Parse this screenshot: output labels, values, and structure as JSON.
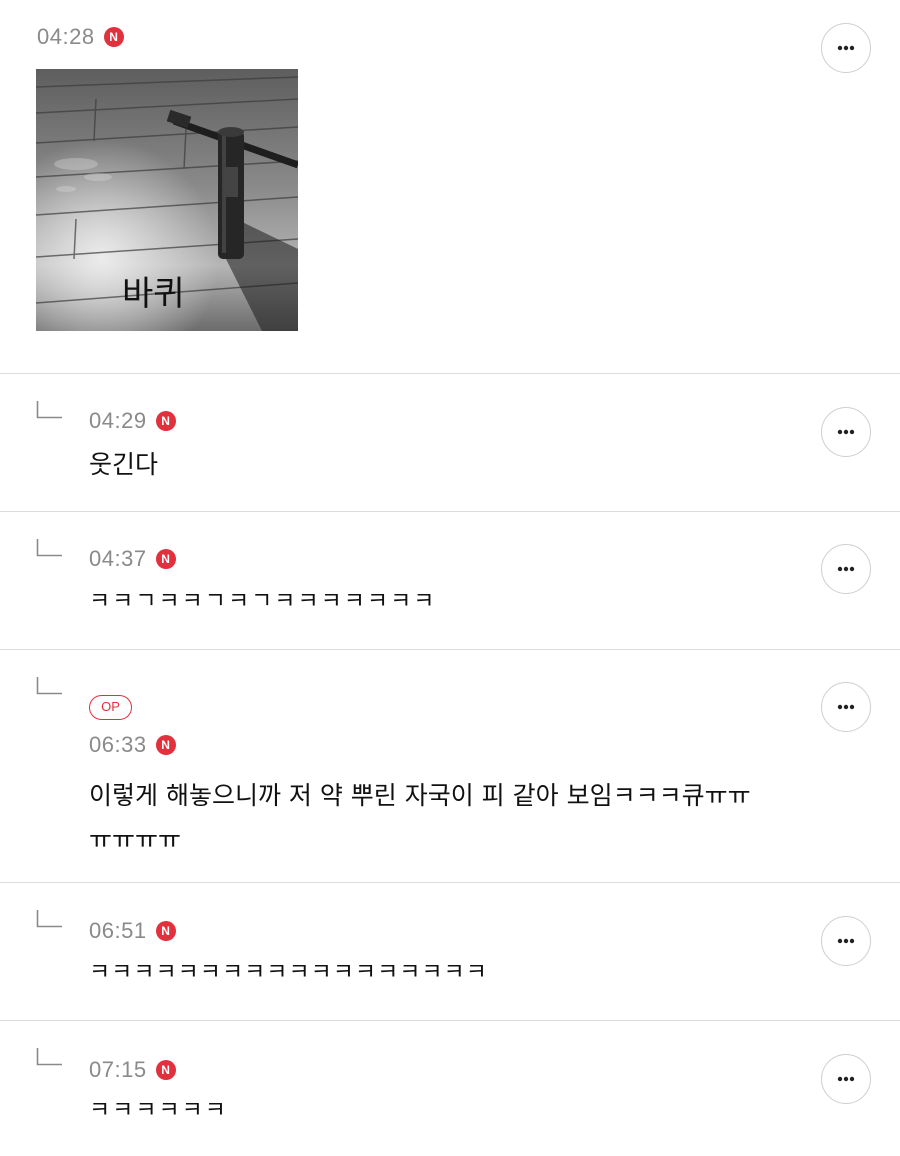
{
  "comments": [
    {
      "time": "04:28",
      "new_badge": "N",
      "is_reply": false,
      "image_caption": "바퀴",
      "more_label": "more options"
    },
    {
      "time": "04:29",
      "new_badge": "N",
      "is_reply": true,
      "text": "웃긴다"
    },
    {
      "time": "04:37",
      "new_badge": "N",
      "is_reply": true,
      "text": "ㅋㅋㄱㅋㅋㄱㅋㄱㅋㅋㅋㅋㅋㅋㅋ"
    },
    {
      "time": "06:33",
      "new_badge": "N",
      "is_reply": true,
      "op_badge": "OP",
      "text": "이렇게 해놓으니까 저 약 뿌린 자국이 피 같아 보임ㅋㅋㅋ큐ㅠㅠ\nㅠㅠㅠㅠ"
    },
    {
      "time": "06:51",
      "new_badge": "N",
      "is_reply": true,
      "text": "ㅋㅋㅋㅋㅋㅋㅋㅋㅋㅋㅋㅋㅋㅋㅋㅋㅋㅋ"
    },
    {
      "time": "07:15",
      "new_badge": "N",
      "is_reply": true,
      "text": "ㅋㅋㅋㅋㅋㅋ"
    }
  ],
  "icons": {
    "more": "more-horizontal-icon",
    "reply": "reply-arrow-icon",
    "new": "new-badge"
  },
  "colors": {
    "accent": "#e0313d",
    "time": "#8a8a8a",
    "divider": "#dcdcdc"
  }
}
